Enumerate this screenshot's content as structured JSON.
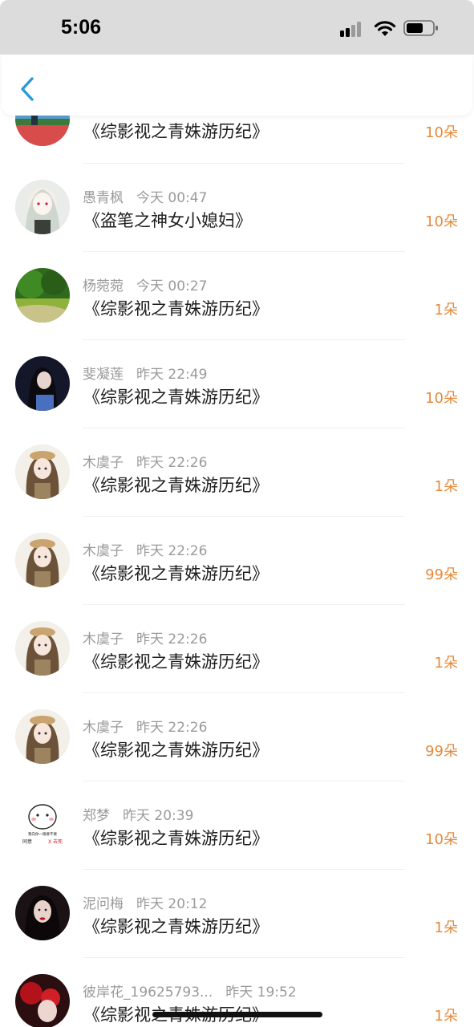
{
  "status_bar": {
    "time": "5:06"
  },
  "records": [
    {
      "title": "《综影视之青姝游历纪》",
      "amount": "10朵",
      "avatar": "colorful-scene-avatar"
    },
    {
      "name": "愚青枫",
      "time": "今天 00:47",
      "title": "《盗笔之神女小媳妇》",
      "amount": "10朵",
      "avatar": "anime-girl-avatar"
    },
    {
      "name": "杨菀菀",
      "time": "今天 00:27",
      "title": "《综影视之青姝游历纪》",
      "amount": "1朵",
      "avatar": "forest-avatar"
    },
    {
      "name": "斐凝莲",
      "time": "昨天 22:49",
      "title": "《综影视之青姝游历纪》",
      "amount": "10朵",
      "avatar": "dark-girl-avatar"
    },
    {
      "name": "木虞子",
      "time": "昨天 22:26",
      "title": "《综影视之青姝游历纪》",
      "amount": "1朵",
      "avatar": "beret-girl-avatar"
    },
    {
      "name": "木虞子",
      "time": "昨天 22:26",
      "title": "《综影视之青姝游历纪》",
      "amount": "99朵",
      "avatar": "beret-girl-avatar"
    },
    {
      "name": "木虞子",
      "time": "昨天 22:26",
      "title": "《综影视之青姝游历纪》",
      "amount": "1朵",
      "avatar": "beret-girl-avatar"
    },
    {
      "name": "木虞子",
      "time": "昨天 22:26",
      "title": "《综影视之青姝游历纪》",
      "amount": "99朵",
      "avatar": "beret-girl-avatar"
    },
    {
      "name": "郑梦",
      "time": "昨天 20:39",
      "title": "《综影视之青姝游历纪》",
      "amount": "10朵",
      "avatar": "cartoon-meme-avatar",
      "avatar_text": {
        "top": "我向你一眼要不要",
        "left": "同意",
        "right": "X 去死"
      }
    },
    {
      "name": "泥问梅",
      "time": "昨天 20:12",
      "title": "《综影视之青姝游历纪》",
      "amount": "1朵",
      "avatar": "red-lip-girl-avatar"
    },
    {
      "name": "彼岸花_19625793...",
      "time": "昨天 19:52",
      "title": "《综影视之青姝游历纪》",
      "amount": "1朵",
      "avatar": "red-flower-avatar"
    }
  ],
  "colors": {
    "accent_amount": "#e58a3b",
    "back_arrow": "#2a9bd8",
    "meta_text": "#9a9a9a"
  }
}
